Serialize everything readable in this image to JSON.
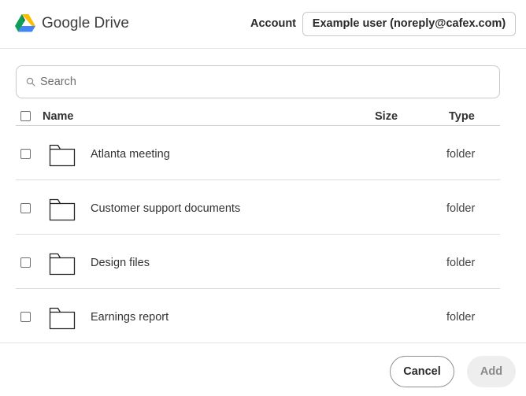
{
  "header": {
    "app_title": "Google Drive",
    "logo_icon": "google-drive-logo-icon",
    "account_label": "Account",
    "account_button": "Example user (noreply@cafex.com)"
  },
  "search": {
    "placeholder": "Search",
    "value": "",
    "icon": "search-icon"
  },
  "table": {
    "columns": {
      "name": "Name",
      "size": "Size",
      "type": "Type"
    },
    "select_all_checked": false,
    "rows": [
      {
        "name": "Atlanta meeting",
        "size": "",
        "type": "folder",
        "checked": false,
        "icon": "folder-icon"
      },
      {
        "name": "Customer support documents",
        "size": "",
        "type": "folder",
        "checked": false,
        "icon": "folder-icon"
      },
      {
        "name": "Design files",
        "size": "",
        "type": "folder",
        "checked": false,
        "icon": "folder-icon"
      },
      {
        "name": "Earnings report",
        "size": "",
        "type": "folder",
        "checked": false,
        "icon": "folder-icon"
      }
    ]
  },
  "footer": {
    "cancel_label": "Cancel",
    "add_label": "Add",
    "add_enabled": false
  },
  "colors": {
    "border": "#c9c9c9",
    "text": "#333333",
    "disabled_button_bg": "#eeeeee",
    "drive_yellow": "#FBBC04",
    "drive_green": "#0F9D58",
    "drive_blue": "#4285F4"
  }
}
